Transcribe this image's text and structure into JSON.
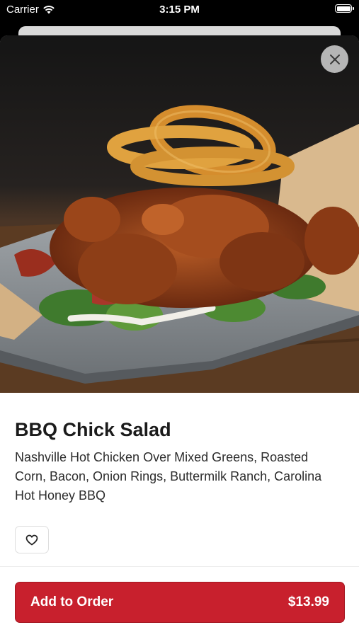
{
  "status_bar": {
    "carrier": "Carrier",
    "time": "3:15 PM"
  },
  "item": {
    "title": "BBQ Chick Salad",
    "description": "Nashville Hot Chicken Over Mixed Greens, Roasted Corn, Bacon, Onion Rings, Buttermilk Ranch, Carolina Hot Honey BBQ",
    "image_alt": "BBQ Chick Salad"
  },
  "actions": {
    "add_label": "Add to Order",
    "price": "$13.99"
  },
  "colors": {
    "accent": "#c8202d"
  },
  "icons": {
    "close": "close-icon",
    "favorite": "heart-icon",
    "wifi": "wifi-icon",
    "battery": "battery-icon"
  }
}
